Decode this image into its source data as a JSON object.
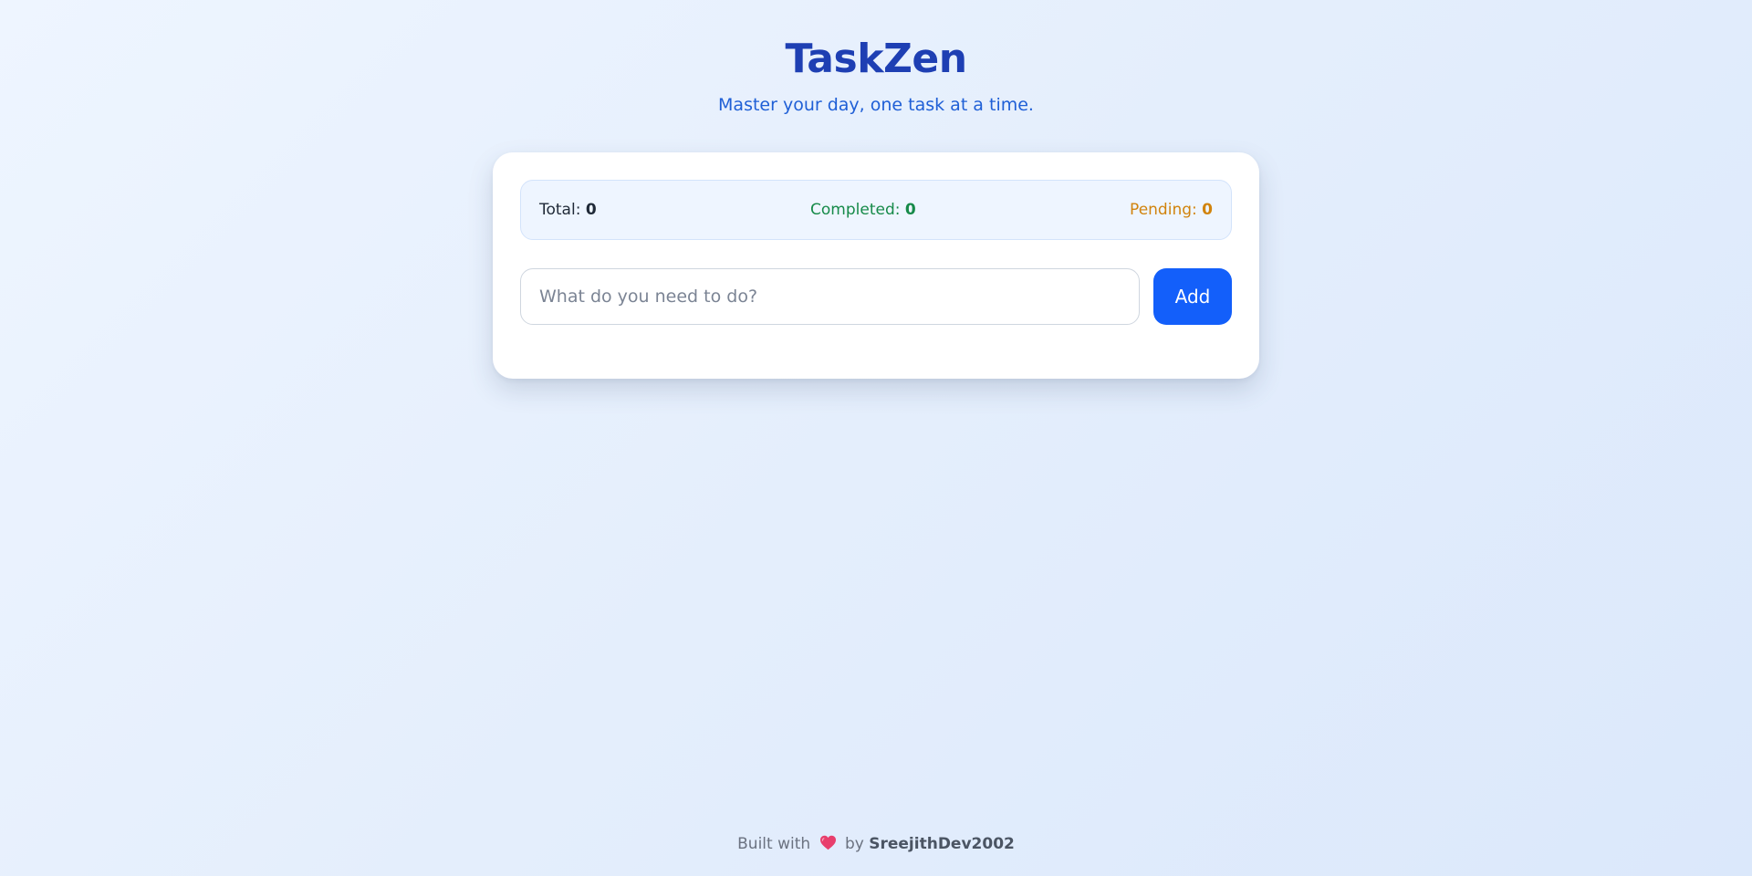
{
  "header": {
    "title": "TaskZen",
    "subtitle": "Master your day, one task at a time."
  },
  "stats": {
    "total_label": "Total:",
    "total_value": "0",
    "completed_label": "Completed:",
    "completed_value": "0",
    "pending_label": "Pending:",
    "pending_value": "0"
  },
  "task_input": {
    "placeholder": "What do you need to do?",
    "value": ""
  },
  "add_button": {
    "label": "Add"
  },
  "footer": {
    "prefix": "Built with",
    "icon": "heart-icon",
    "middle": "by",
    "author": "SreejithDev2002"
  },
  "colors": {
    "title": "#1e3fb3",
    "subtitle": "#1f5fd6",
    "accent": "#135ffa",
    "completed": "#168a49",
    "pending": "#d1830c",
    "heart": "#e83e6c"
  }
}
